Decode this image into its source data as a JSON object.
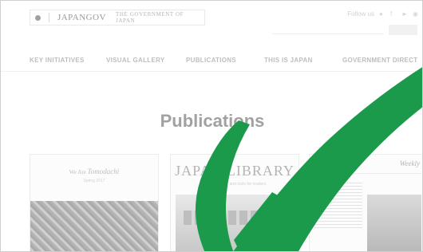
{
  "header": {
    "logo_text": "JAPANGOV",
    "logo_subtitle": "THE GOVERNMENT OF JAPAN",
    "follow_label": "Follow us",
    "social_icons": [
      "twitter-icon",
      "facebook-icon",
      "youtube-icon",
      "rss-icon"
    ]
  },
  "nav": {
    "items": [
      {
        "label": "KEY INITIATIVES"
      },
      {
        "label": "VISUAL GALLERY"
      },
      {
        "label": "PUBLICATIONS"
      },
      {
        "label": "THIS IS JAPAN"
      },
      {
        "label": "GOVERNMENT DIRECT"
      }
    ]
  },
  "main": {
    "title": "Publications"
  },
  "cards": {
    "tomodachi": {
      "title_prefix": "We Are",
      "title_main": "Tomodachi",
      "subtitle": "Spring 2017"
    },
    "library": {
      "title": "JAPAN LIBRARY",
      "subtitle": "Books, media, and tools for readers"
    },
    "weekly": {
      "title": "Weekly"
    }
  },
  "overlay": {
    "icon": "checkmark-icon",
    "color": "#1a9a4a",
    "page_tint": "#9a9a9a"
  }
}
